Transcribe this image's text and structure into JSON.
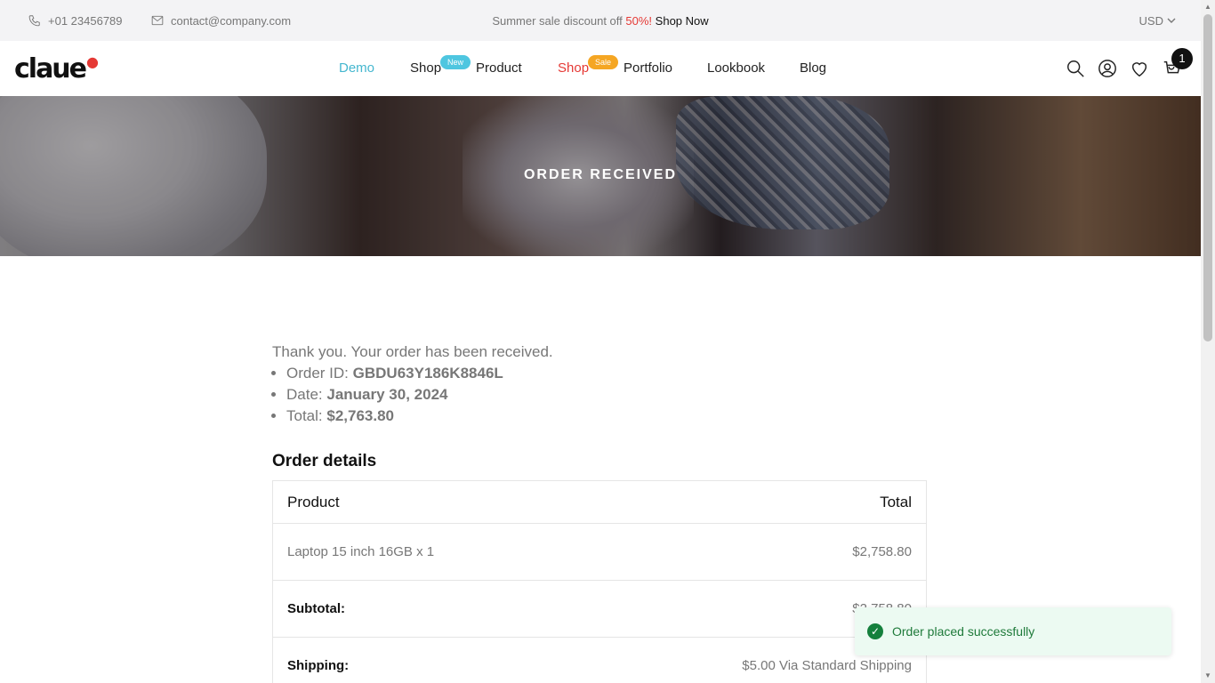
{
  "topbar": {
    "phone": "+01 23456789",
    "email": "contact@company.com",
    "promo_text": "Summer sale discount off",
    "promo_percent": "50%!",
    "promo_link": "Shop Now",
    "currency": "USD"
  },
  "header": {
    "logo": "claue",
    "nav": [
      {
        "label": "Demo"
      },
      {
        "label": "Shop",
        "badge": "New"
      },
      {
        "label": "Product"
      },
      {
        "label": "Shop",
        "badge": "Sale"
      },
      {
        "label": "Portfolio"
      },
      {
        "label": "Lookbook"
      },
      {
        "label": "Blog"
      }
    ],
    "cart_count": "1",
    "icons": [
      "search-icon",
      "user-icon",
      "heart-icon",
      "cart-icon"
    ]
  },
  "banner": {
    "title": "ORDER RECEIVED"
  },
  "order": {
    "thanks": "Thank you. Your order has been received.",
    "id_label": "Order ID:",
    "id_value": "GBDU63Y186K8846L",
    "date_label": "Date:",
    "date_value": "January 30, 2024",
    "total_label": "Total:",
    "total_value": "$2,763.80"
  },
  "details": {
    "title": "Order details",
    "columns": [
      "Product",
      "Total"
    ],
    "items": [
      {
        "name": "Laptop 15 inch 16GB x 1",
        "total": "$2,758.80"
      }
    ],
    "subtotal_label": "Subtotal:",
    "subtotal_value": "$2,758.80",
    "shipping_label": "Shipping:",
    "shipping_value": "$5.00 Via Standard Shipping"
  },
  "toast": {
    "message": "Order placed successfully"
  },
  "colors": {
    "accent": "#45b7cf",
    "sale_red": "#e53935",
    "badge_new": "#4ec6e0",
    "badge_sale": "#f5a623",
    "success": "#15803d"
  }
}
